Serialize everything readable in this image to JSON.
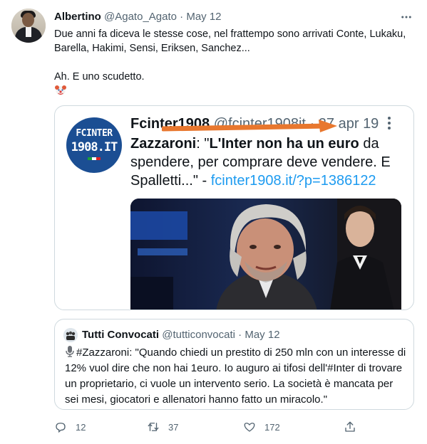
{
  "tweet": {
    "author_name": "Albertino",
    "author_handle": "@Agato_Agato",
    "separator": "·",
    "date": "May 12",
    "more_icon": "more-dots-icon",
    "lines": [
      "Due anni fa diceva le stesse cose, nel frattempo sono arrivati Conte, Lukaku,",
      "Barella, Hakimi, Sensi, Eriksen, Sanchez...",
      "",
      "Ah. E uno scudetto."
    ],
    "emoji": "clown-face-emoji"
  },
  "quoted_tweet": {
    "logo_line1": "FCINTER",
    "logo_line2": "1908.IT",
    "author_name": "Fcinter1908",
    "author_handle": "@fcinter1908it",
    "separator": "·",
    "date": "27 apr 19",
    "text_bold": "Zazzaroni",
    "text_a": ": \"",
    "text_bold2": "L'Inter non ha un euro",
    "text_b": " da spendere, per comprare deve vendere. E Spalletti...\" - ",
    "link": "fcinter1908.it/?p=1386122",
    "annotation_color": "#e8772e"
  },
  "quoted_tweet_2": {
    "author_name": "Tutti Convocati",
    "author_handle": "@tutticonvocati",
    "separator": "·",
    "date": "May 12",
    "text": "#Zazzaroni: \"Quando chiedi un prestito di 250 mln con un interesse di 12% vuol dire che non hai 1euro. Io auguro ai tifosi dell'#Inter di trovare un proprietario, ci vuole un intervento serio. La società è mancata per sei mesi, giocatori e allenatori hanno fatto un miracolo.\""
  },
  "actions": {
    "replies": "12",
    "retweets": "37",
    "likes": "172"
  },
  "colors": {
    "text": "#0f1419",
    "secondary": "#536471",
    "link": "#1d9bf0",
    "border": "#cfd9de",
    "logo_bg": "#1b4e93"
  }
}
